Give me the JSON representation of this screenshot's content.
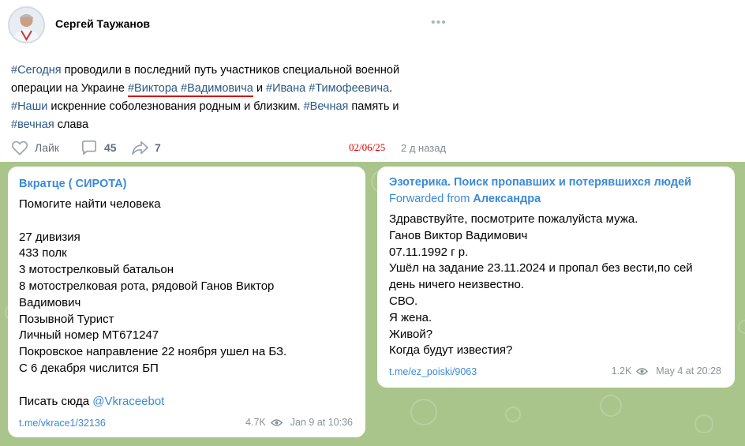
{
  "post": {
    "author": "Сергей Таужанов",
    "text_parts": {
      "tag1": "#Сегодня",
      "t1": " проводили в последний путь участников специальной военной операции на Украине ",
      "tag2": "#Виктора",
      "sp1": " ",
      "tag3": "#Вадимовича",
      "t2": " и ",
      "tag4": "#Ивана",
      "sp2": " ",
      "tag5": "#Тимофеевича",
      "t3": ".",
      "tag6": "#Наши",
      "t4": " искренние соболезнования родным и близким. ",
      "tag7": "#Вечная",
      "t5": " память и ",
      "tag8": "#вечная",
      "t6": " слава"
    },
    "like_label": "Лайк",
    "comments_count": "45",
    "shares_count": "7",
    "handwritten_date": "02/06/25",
    "time_ago": "2 д назад",
    "accent_color": "#2a5885",
    "underline_color": "#d50000"
  },
  "messages": [
    {
      "channel": "Вкратце ( СИРОТА)",
      "lines": [
        "Помогите найти человека",
        "",
        "27 дивизия",
        "433 полк",
        "3 мотострелковый батальон",
        "8 мотострелковая рота, рядовой Ганов Виктор",
        "Вадимович",
        "Позывной Турист",
        "Личный номер МТ671247",
        "Покровское направление 22 ноября ушел на БЗ.",
        "С 6 декабря числится БП",
        ""
      ],
      "contact_prefix": "Писать сюда ",
      "contact_link": "@Vkraceebot",
      "link": "t.me/vkrace1/32136",
      "views": "4.7K",
      "time": "Jan 9 at 10:36"
    },
    {
      "channel": "Эзотерика. Поиск пропавших и потерявшихся людей",
      "forwarded_prefix": "Forwarded from ",
      "forwarded_name": "Александра",
      "lines": [
        "Здравствуйте, посмотрите пожалуйста мужа.",
        "Ганов Виктор Вадимович",
        "07.11.1992 г р.",
        "Ушёл на задание 23.11.2024 и пропал без вести,по сей",
        "день ничего неизвестно.",
        "СВО.",
        "Я жена.",
        "Живой?",
        "Когда будут известия?"
      ],
      "link": "t.me/ez_poiski/9063",
      "views": "1.2K",
      "time": "May 4 at 20:28"
    }
  ],
  "colors": {
    "telegram_background": "#aac58c",
    "telegram_link": "#3a8ad8",
    "meta_gray": "#8a9196",
    "stamp_red": "#e00000"
  },
  "icons": [
    "avatar",
    "more-dots-icon",
    "heart-icon",
    "comment-icon",
    "share-icon",
    "views-eye-icon"
  ]
}
